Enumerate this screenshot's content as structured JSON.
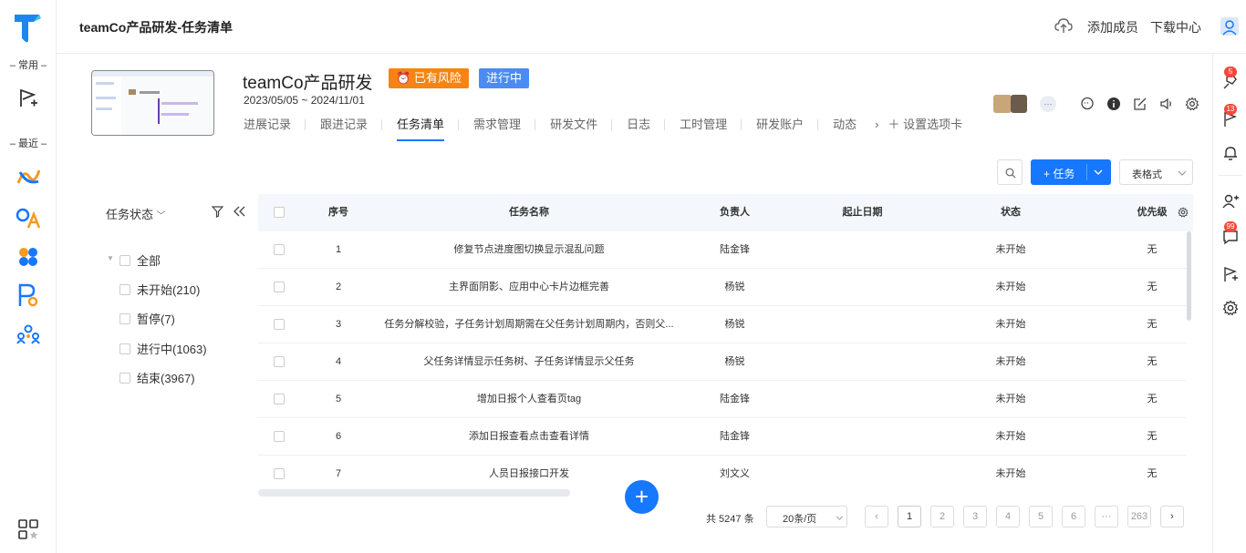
{
  "app": {
    "brand_color": "#1677ff"
  },
  "leftbar": {
    "section_common": "– 常用 –",
    "section_recent": "– 最近 –",
    "recent_icons": [
      "dashboard-app-icon",
      "oa-app-icon",
      "apps-cluster-icon",
      "po-app-icon",
      "team-app-icon"
    ]
  },
  "topbar": {
    "title": "teamCo产品研发-任务清单",
    "add_member": "添加成员",
    "download_center": "下载中心"
  },
  "project": {
    "name": "teamCo产品研发",
    "risk_tag": "已有风险",
    "status_tag": "进行中",
    "dates": "2023/05/05 ~ 2024/11/01",
    "tabs": [
      "进展记录",
      "跟进记录",
      "任务清单",
      "需求管理",
      "研发文件",
      "日志",
      "工时管理",
      "研发账户",
      "动态"
    ],
    "active_tab": "任务清单",
    "settings_tab": "设置选项卡",
    "member_more": "···"
  },
  "toolbar": {
    "add_task": "+ 任务",
    "view_mode": "表格式"
  },
  "filter": {
    "title": "任务状态",
    "items": [
      {
        "label": "全部"
      },
      {
        "label": "未开始(210)"
      },
      {
        "label": "暂停(7)"
      },
      {
        "label": "进行中(1063)"
      },
      {
        "label": "结束(3967)"
      }
    ]
  },
  "table": {
    "headers": [
      "序号",
      "任务名称",
      "负责人",
      "起止日期",
      "状态",
      "优先级"
    ],
    "rows": [
      {
        "no": "1",
        "name": "修复节点进度图切换显示混乱问题",
        "owner": "陆金锋",
        "dates": "",
        "status": "未开始",
        "priority": "无"
      },
      {
        "no": "2",
        "name": "主界面阴影、应用中心卡片边框完善",
        "owner": "杨锐",
        "dates": "",
        "status": "未开始",
        "priority": "无"
      },
      {
        "no": "3",
        "name": "任务分解校验，子任务计划周期需在父任务计划周期内，否则父...",
        "owner": "杨锐",
        "dates": "",
        "status": "未开始",
        "priority": "无"
      },
      {
        "no": "4",
        "name": "父任务详情显示任务树、子任务详情显示父任务",
        "owner": "杨锐",
        "dates": "",
        "status": "未开始",
        "priority": "无"
      },
      {
        "no": "5",
        "name": "增加日报个人查看页tag",
        "owner": "陆金锋",
        "dates": "",
        "status": "未开始",
        "priority": "无"
      },
      {
        "no": "6",
        "name": "添加日报查看点击查看详情",
        "owner": "陆金锋",
        "dates": "",
        "status": "未开始",
        "priority": "无"
      },
      {
        "no": "7",
        "name": "人员日报接口开发",
        "owner": "刘文义",
        "dates": "",
        "status": "未开始",
        "priority": "无"
      }
    ]
  },
  "pagination": {
    "total": "共 5247 条",
    "page_size": "20条/页",
    "pages": [
      "1",
      "2",
      "3",
      "4",
      "5",
      "6",
      "···",
      "263"
    ],
    "current": "1"
  },
  "rightbar": {
    "badges": [
      "5",
      "13",
      "99"
    ]
  }
}
